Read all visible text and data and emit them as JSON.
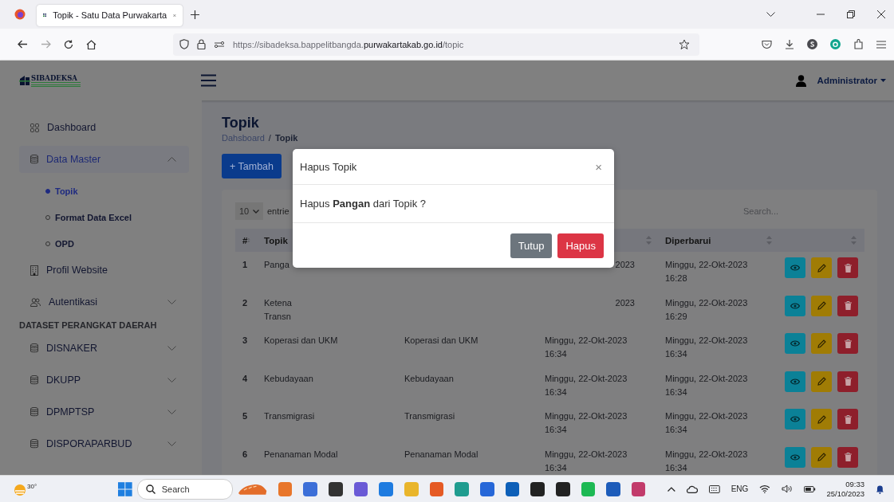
{
  "browser": {
    "tab_title": "Topik - Satu Data Purwakarta",
    "url": {
      "prefix": "https://sibadeksa.bappelitbangda.",
      "domain": "purwakartakab.go.id",
      "suffix": "/topic"
    }
  },
  "header": {
    "logo_text": "SIBADEKSA",
    "user": "Administrator"
  },
  "sidebar": {
    "items": [
      {
        "kind": "link",
        "label": "Dashboard",
        "selected": false
      },
      {
        "kind": "group",
        "label": "Data Master",
        "selected": true,
        "expanded": true,
        "children": [
          {
            "label": "Topik",
            "selected": true
          },
          {
            "label": "Format Data Excel",
            "selected": false
          },
          {
            "label": "OPD",
            "selected": false
          }
        ]
      },
      {
        "kind": "link",
        "label": "Profil Website",
        "selected": false
      },
      {
        "kind": "group",
        "label": "Autentikasi",
        "selected": false,
        "expanded": false
      },
      {
        "kind": "section",
        "label": "DATASET PERANGKAT DAERAH"
      },
      {
        "kind": "group",
        "label": "DISNAKER",
        "selected": false,
        "expanded": false
      },
      {
        "kind": "group",
        "label": "DKUPP",
        "selected": false,
        "expanded": false
      },
      {
        "kind": "group",
        "label": "DPMPTSP",
        "selected": false,
        "expanded": false
      },
      {
        "kind": "group",
        "label": "DISPORAPARBUD",
        "selected": false,
        "expanded": false
      }
    ]
  },
  "page": {
    "title": "Topik",
    "breadcrumb": [
      "Dahsboard",
      "Topik"
    ],
    "breadcrumb_separator": "/",
    "add_button": "+ Tambah"
  },
  "table": {
    "length": "10",
    "entries_label": "entrie",
    "search": {
      "placeholder": "Search..."
    },
    "columns": [
      {
        "label": "#",
        "sortable": true
      },
      {
        "label": "Topik"
      },
      {},
      {
        "sortable": true
      },
      {
        "label": "Diperbarui",
        "sortable": true
      },
      {
        "sortable": true
      }
    ],
    "rows": [
      {
        "number": "1",
        "topik": [
          "Panga"
        ],
        "column_4": [
          "2023"
        ],
        "diperbarui": [
          "Minggu, 22-Okt-2023",
          "16:28"
        ]
      },
      {
        "number": "2",
        "topik": [
          "Ketena",
          "Transn"
        ],
        "column_4": [
          "2023"
        ],
        "diperbarui": [
          "Minggu, 22-Okt-2023",
          "16:29"
        ]
      },
      {
        "number": "3",
        "topik": [
          "Koperasi dan UKM"
        ],
        "column_3": [
          "Koperasi dan UKM"
        ],
        "column_4": [
          "Minggu, 22-Okt-2023",
          "16:34"
        ],
        "diperbarui": [
          "Minggu, 22-Okt-2023",
          "16:34"
        ]
      },
      {
        "number": "4",
        "topik": [
          "Kebudayaan"
        ],
        "column_3": [
          "Kebudayaan"
        ],
        "column_4": [
          "Minggu, 22-Okt-2023",
          "16:34"
        ],
        "diperbarui": [
          "Minggu, 22-Okt-2023",
          "16:34"
        ]
      },
      {
        "number": "5",
        "topik": [
          "Transmigrasi"
        ],
        "column_3": [
          "Transmigrasi"
        ],
        "column_4": [
          "Minggu, 22-Okt-2023",
          "16:34"
        ],
        "diperbarui": [
          "Minggu, 22-Okt-2023",
          "16:34"
        ]
      },
      {
        "number": "6",
        "topik": [
          "Penanaman Modal"
        ],
        "column_3": [
          "Penanaman Modal"
        ],
        "column_4": [
          "Minggu, 22-Okt-2023",
          "16:34"
        ],
        "diperbarui": [
          "Minggu, 22-Okt-2023",
          "16:34"
        ]
      }
    ]
  },
  "modal": {
    "title": "Hapus Topik",
    "close": "×",
    "message": "Hapus **Pangan** dari Topik ?",
    "buttons": [
      {
        "label": "Tutup",
        "kind": "secondary"
      },
      {
        "label": "Hapus",
        "kind": "danger"
      }
    ]
  },
  "taskbar": {
    "weather": "30°",
    "search": {
      "placeholder": "Search"
    },
    "language": "ENG",
    "time": "09:33",
    "date": "25/10/2023"
  }
}
